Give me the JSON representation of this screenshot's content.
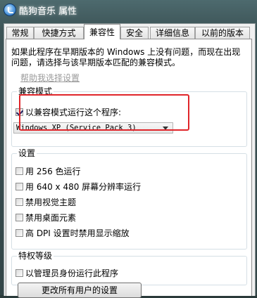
{
  "window": {
    "title": "酷狗音乐 属性"
  },
  "tabs": [
    {
      "label": "常规"
    },
    {
      "label": "快捷方式"
    },
    {
      "label": "兼容性"
    },
    {
      "label": "安全"
    },
    {
      "label": "详细信息"
    },
    {
      "label": "以前的版本"
    }
  ],
  "active_tab": "兼容性",
  "description": "如果此程序在早期版本的 Windows 上没有问题，而现在出现问题，请选择与该早期版本匹配的兼容模式。",
  "help_link": "帮助我选择设置",
  "compat_mode": {
    "group_label": "兼容模式",
    "checkbox_label": "以兼容模式运行这个程序:",
    "checked": true,
    "selected_os": "Windows XP (Service Pack 3)"
  },
  "settings": {
    "group_label": "设置",
    "options": [
      {
        "label": "用 256 色运行",
        "checked": false
      },
      {
        "label": "用 640 x 480 屏幕分辨率运行",
        "checked": false
      },
      {
        "label": "禁用视觉主题",
        "checked": false
      },
      {
        "label": "禁用桌面元素",
        "checked": false
      },
      {
        "label": "高 DPI 设置时禁用显示缩放",
        "checked": false
      }
    ]
  },
  "privilege": {
    "group_label": "特权等级",
    "checkbox_label": "以管理员身份运行此程序",
    "checked": false
  },
  "button_all_users": "更改所有用户的设置",
  "colors": {
    "highlight": "#e0252a",
    "link": "#9a9a9a",
    "window_frame": "#3d5457"
  }
}
